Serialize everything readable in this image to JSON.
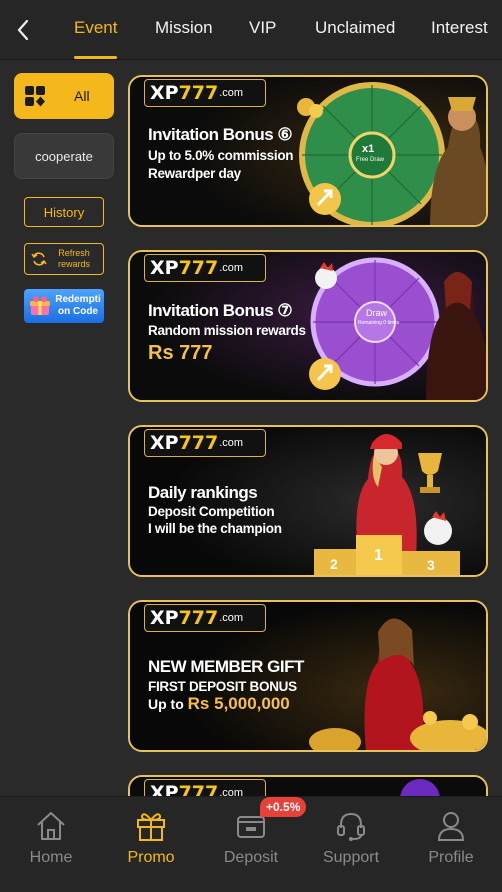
{
  "header": {
    "tabs": [
      "Event",
      "Mission",
      "VIP",
      "Unclaimed",
      "Interest"
    ],
    "active_tab": "Event"
  },
  "side": {
    "all_label": "All",
    "cooperate_label": "cooperate",
    "history_label": "History",
    "refresh_label_1": "Refresh",
    "refresh_label_2": "rewards",
    "redeem_label_1": "Redempti",
    "redeem_label_2": "on Code"
  },
  "logo": {
    "xp": "XP",
    "num": "777",
    "com": ".com"
  },
  "banners": [
    {
      "title": "Invitation Bonus ⑥",
      "line1": "Up to 5.0% commission",
      "line2": "Rewardper day",
      "wheel_center": "x1",
      "wheel_sub": "Free Draw"
    },
    {
      "title": "Invitation Bonus ⑦",
      "line1": "Random mission rewards",
      "big": "Rs 777",
      "wheel_center": "Draw",
      "wheel_sub": "Remaining 0 times"
    },
    {
      "title": "Daily rankings",
      "line1": "Deposit Competition",
      "line2": "I will be the champion",
      "podium": [
        "2",
        "1",
        "3"
      ]
    },
    {
      "title": "NEW MEMBER GIFT",
      "line1": "FIRST DEPOSIT BONUS",
      "line2_prefix": "Up to ",
      "line2_value": "Rs 5,000,000"
    }
  ],
  "nav": {
    "items": [
      "Home",
      "Promo",
      "Deposit",
      "Support",
      "Profile"
    ],
    "active": "Promo",
    "deposit_badge": "+0.5%"
  },
  "colors": {
    "accent": "#f5b81c",
    "background": "#2a2a2a",
    "badge": "#e8413a"
  }
}
